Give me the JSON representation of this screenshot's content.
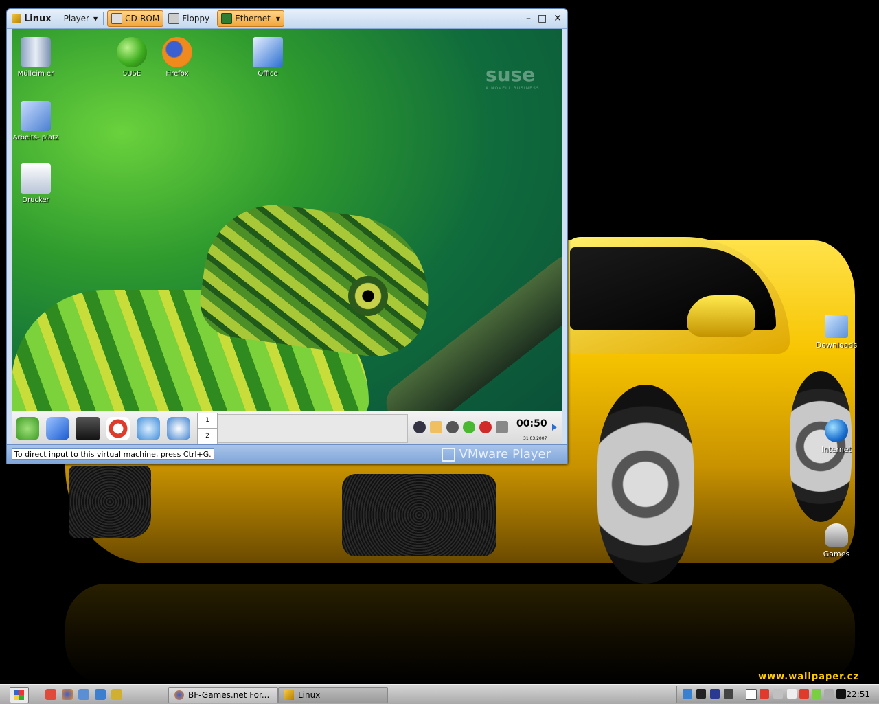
{
  "colors": {
    "host_wallpaper": "#000000",
    "car_yellow": "#f7c400",
    "vm_frame": "#cfe0f3",
    "vm_title_gradient_top": "#e9f1fb",
    "active_device_orange": "#f3a63a",
    "kde_panel": "#e0e0e0",
    "host_taskbar": "#b9b9b9"
  },
  "host_desktop": {
    "watermark": "www.wallpaper.cz",
    "icons": [
      {
        "label": "Downloads",
        "icon": "folder-icon"
      },
      {
        "label": "Internet",
        "icon": "globe-icon"
      },
      {
        "label": "Games",
        "icon": "joystick-icon"
      }
    ]
  },
  "vm_window": {
    "title": "Linux",
    "player_menu": "Player",
    "devices": {
      "cdrom": "CD-ROM",
      "floppy": "Floppy",
      "ethernet": "Ethernet"
    },
    "window_controls": {
      "minimize": "–",
      "maximize": "□",
      "close": "✕"
    },
    "status_message": "To direct input to this virtual machine, press Ctrl+G.",
    "brand": "VMware Player"
  },
  "guest": {
    "watermark": {
      "logo": "suse",
      "tagline": "A NOVELL BUSINESS"
    },
    "icons": {
      "trash": "Mülleim er",
      "suse": "SUSE",
      "firefox": "Firefox",
      "office": "Office",
      "computer": "Arbeits- platz",
      "printer": "Drucker"
    },
    "panel": {
      "pager": [
        "1",
        "2"
      ],
      "clock": "00:50",
      "date": "31.03.2007"
    }
  },
  "host_taskbar": {
    "tasks": [
      {
        "label": "BF-Games.net For...",
        "icon": "firefox-icon"
      },
      {
        "label": "Linux",
        "icon": "vmware-icon"
      }
    ],
    "clock": "22:51"
  }
}
